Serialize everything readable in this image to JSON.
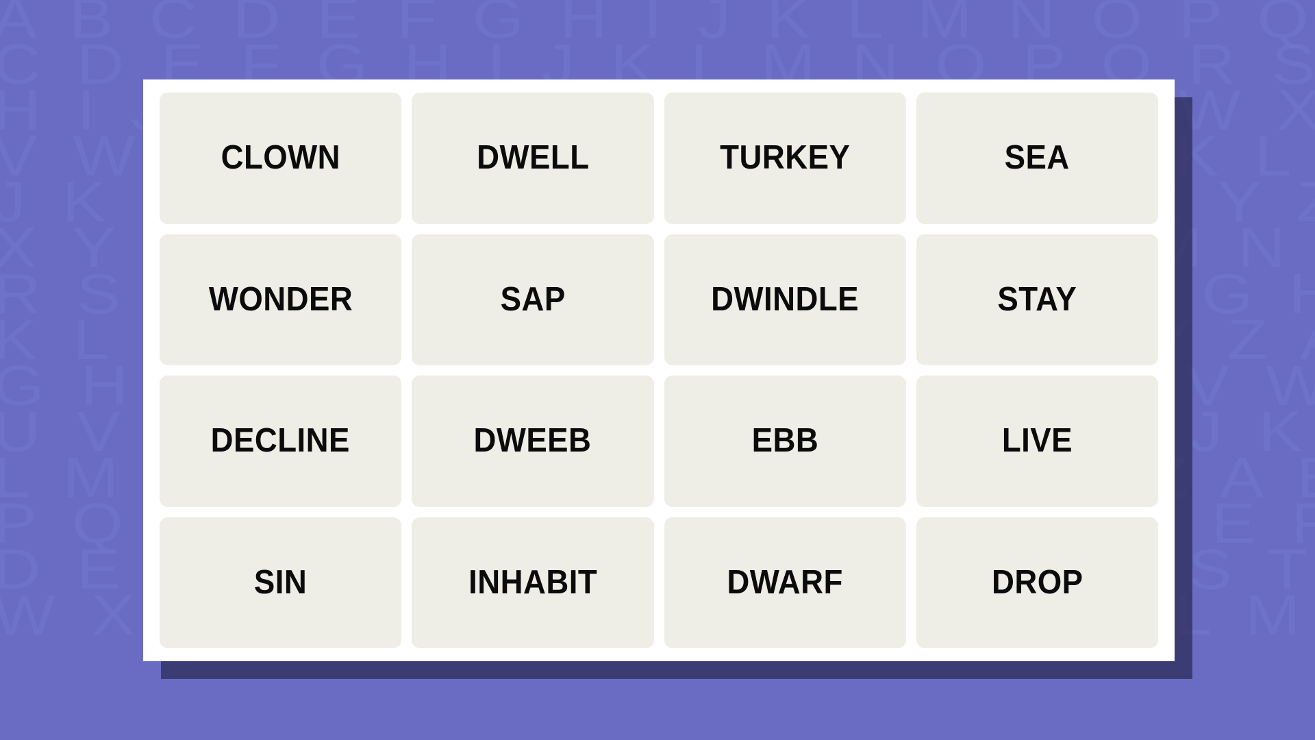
{
  "background": {
    "base_color": "#6a6cc4",
    "letter_color": "#7376cd",
    "rows": [
      "ABCDEFGHIJKLMNOPQRSTUVWXYZABCDEF",
      "CDEFGHIJKLMNOPQRSTUVWXYZABCDEFGH",
      "HIJKLMNOPQRSTUVWXYZABCDEFGHIJKLM",
      "VWXYZABCDEFGHIJKLMNOPQRSTUVWXYZA",
      "JKLMNOPQRSTUVWXYZABCDEFGHIJKLMNO",
      "XYZABCDEFGHIJKLMNOPQRSTUVWXYZABC",
      "RSTUVWXYZABCDEFGHIJKLMNOPQRSTUVW",
      "KLMNOPQRSTUVWXYZABCDEFGHIJKLMNOP",
      "GHIJKLMNOPQRSTUVWXYZABCDEFGHIJKL",
      "UVWXYZABCDEFGHIJKLMNOPQRSTUVWXYZ",
      "LMNOPQRSTUVWXYZABCDEFGHIJKLMNOPQ",
      "PQRSTUVWXYZABCDEFGHIJKLMNOPQRSTU",
      "DEFGHIJKLMNOPQRSTUVWXYZABCDEFGHI",
      "WXYZABCDEFGHIJKLMNOPQRSTUVWXYZAB"
    ]
  },
  "card": {
    "background_color": "#ffffff",
    "shadow_color": "#1f1e40"
  },
  "grid": {
    "columns": 4,
    "rows": 4,
    "tile_background_color": "#eeeee6",
    "tile_text_color": "#0b0b0b",
    "tiles": [
      {
        "label": "CLOWN",
        "row": 1,
        "col": 1
      },
      {
        "label": "DWELL",
        "row": 1,
        "col": 2
      },
      {
        "label": "TURKEY",
        "row": 1,
        "col": 3
      },
      {
        "label": "SEA",
        "row": 1,
        "col": 4
      },
      {
        "label": "WONDER",
        "row": 2,
        "col": 1
      },
      {
        "label": "SAP",
        "row": 2,
        "col": 2
      },
      {
        "label": "DWINDLE",
        "row": 2,
        "col": 3
      },
      {
        "label": "STAY",
        "row": 2,
        "col": 4
      },
      {
        "label": "DECLINE",
        "row": 3,
        "col": 1
      },
      {
        "label": "DWEEB",
        "row": 3,
        "col": 2
      },
      {
        "label": "EBB",
        "row": 3,
        "col": 3
      },
      {
        "label": "LIVE",
        "row": 3,
        "col": 4
      },
      {
        "label": "SIN",
        "row": 4,
        "col": 1
      },
      {
        "label": "INHABIT",
        "row": 4,
        "col": 2
      },
      {
        "label": "DWARF",
        "row": 4,
        "col": 3
      },
      {
        "label": "DROP",
        "row": 4,
        "col": 4
      }
    ]
  }
}
